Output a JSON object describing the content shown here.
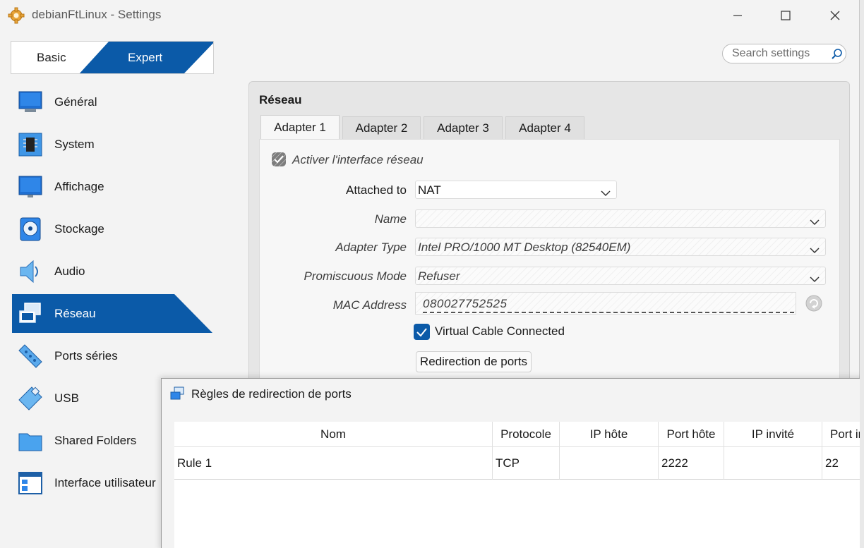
{
  "window": {
    "title": "debianFtLinux - Settings"
  },
  "mode_switch": {
    "basic_label": "Basic",
    "expert_label": "Expert",
    "selected": "Expert"
  },
  "search": {
    "placeholder": "Search settings"
  },
  "sidebar": {
    "items": [
      {
        "label": "Général",
        "icon": "monitor-icon"
      },
      {
        "label": "System",
        "icon": "chip-icon"
      },
      {
        "label": "Affichage",
        "icon": "display-icon"
      },
      {
        "label": "Stockage",
        "icon": "disc-icon"
      },
      {
        "label": "Audio",
        "icon": "speaker-icon"
      },
      {
        "label": "Réseau",
        "icon": "network-icon",
        "active": true
      },
      {
        "label": "Ports séries",
        "icon": "serial-port-icon"
      },
      {
        "label": "USB",
        "icon": "usb-icon"
      },
      {
        "label": "Shared Folders",
        "icon": "folder-icon"
      },
      {
        "label": "Interface utilisateur",
        "icon": "window-layout-icon"
      }
    ]
  },
  "network": {
    "title": "Réseau",
    "tabs": [
      "Adapter 1",
      "Adapter 2",
      "Adapter 3",
      "Adapter 4"
    ],
    "active_tab": "Adapter 1",
    "enable_label": "Activer l'interface réseau",
    "attached_label": "Attached to",
    "attached_value": "NAT",
    "name_label": "Name",
    "name_value": "",
    "adapter_type_label": "Adapter Type",
    "adapter_type_value": "Intel PRO/1000 MT Desktop (82540EM)",
    "promiscuous_label": "Promiscuous Mode",
    "promiscuous_value": "Refuser",
    "mac_label": "MAC Address",
    "mac_value": "080027752525",
    "cable_label": "Virtual Cable Connected",
    "cable_checked": true,
    "port_forward_button": "Redirection de ports"
  },
  "port_dialog": {
    "title": "Règles de redirection de ports",
    "columns": [
      "Nom",
      "Protocole",
      "IP hôte",
      "Port hôte",
      "IP invité",
      "Port in"
    ],
    "rows": [
      [
        "Rule 1",
        "TCP",
        "",
        "2222",
        "",
        "22"
      ]
    ]
  },
  "colors": {
    "accent": "#0b5aa8",
    "active_bg": "#0b5aa8"
  }
}
